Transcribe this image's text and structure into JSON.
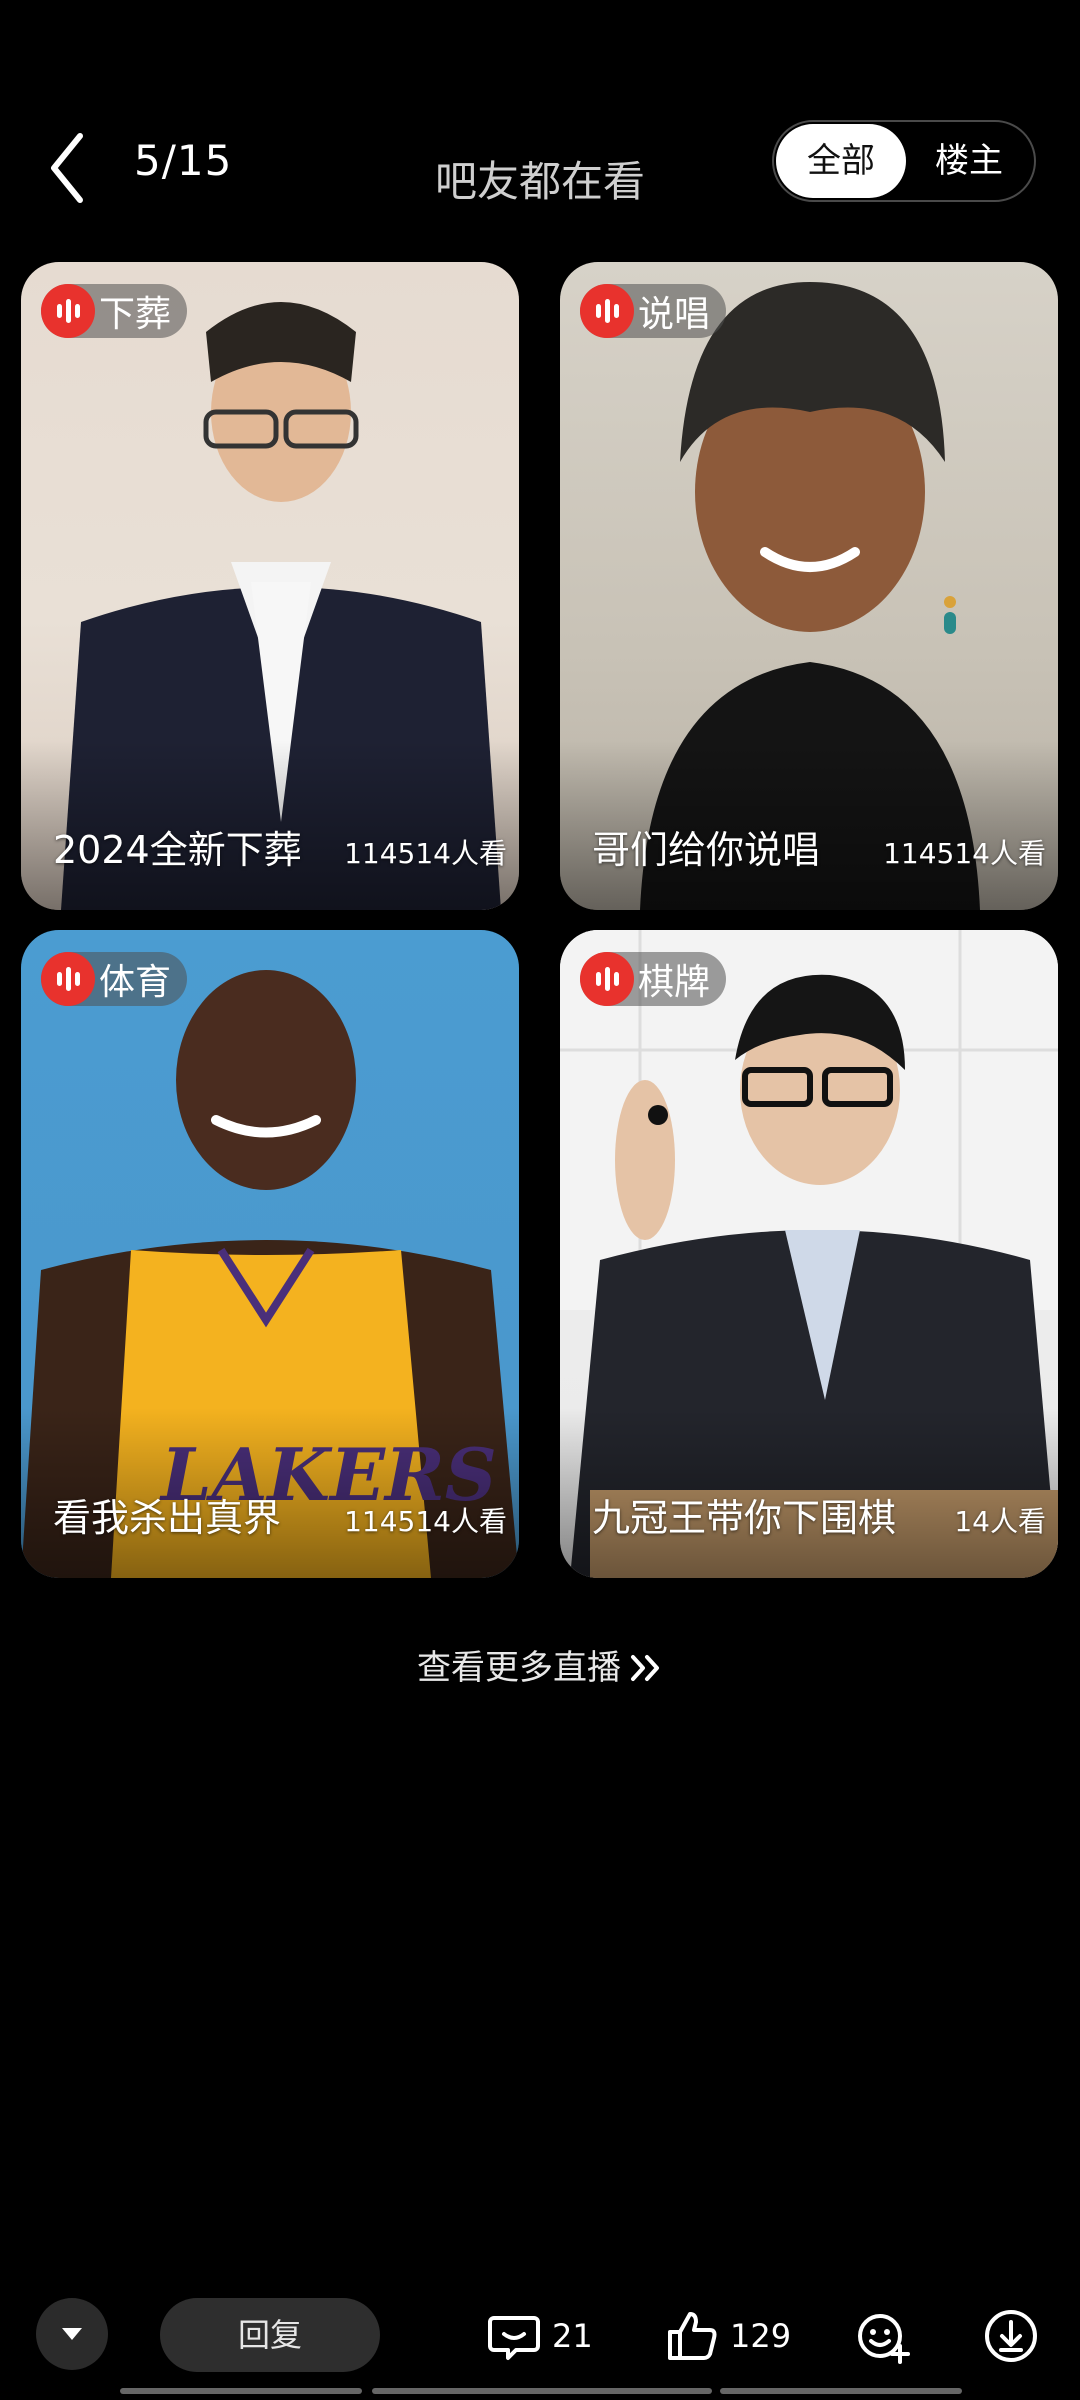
{
  "header": {
    "page_indicator": "5/15",
    "title": "吧友都在看",
    "segments": {
      "all": "全部",
      "owner": "楼主",
      "selected": "全部"
    }
  },
  "cards": [
    {
      "tag": "下葬",
      "title": "2024全新下葬",
      "viewers": "114514人看"
    },
    {
      "tag": "说唱",
      "title": "哥们给你说唱",
      "viewers": "114514人看"
    },
    {
      "tag": "体育",
      "title": "看我杀出真界",
      "viewers": "114514人看"
    },
    {
      "tag": "棋牌",
      "title": "九冠王带你下围棋",
      "viewers": "14人看"
    }
  ],
  "more_link": "查看更多直播",
  "bottom_bar": {
    "reply_label": "回复",
    "comment_count": "21",
    "like_count": "129"
  },
  "colors": {
    "background": "#000000",
    "live_red": "#e8322d",
    "segment_selected_bg": "#ffffff"
  }
}
